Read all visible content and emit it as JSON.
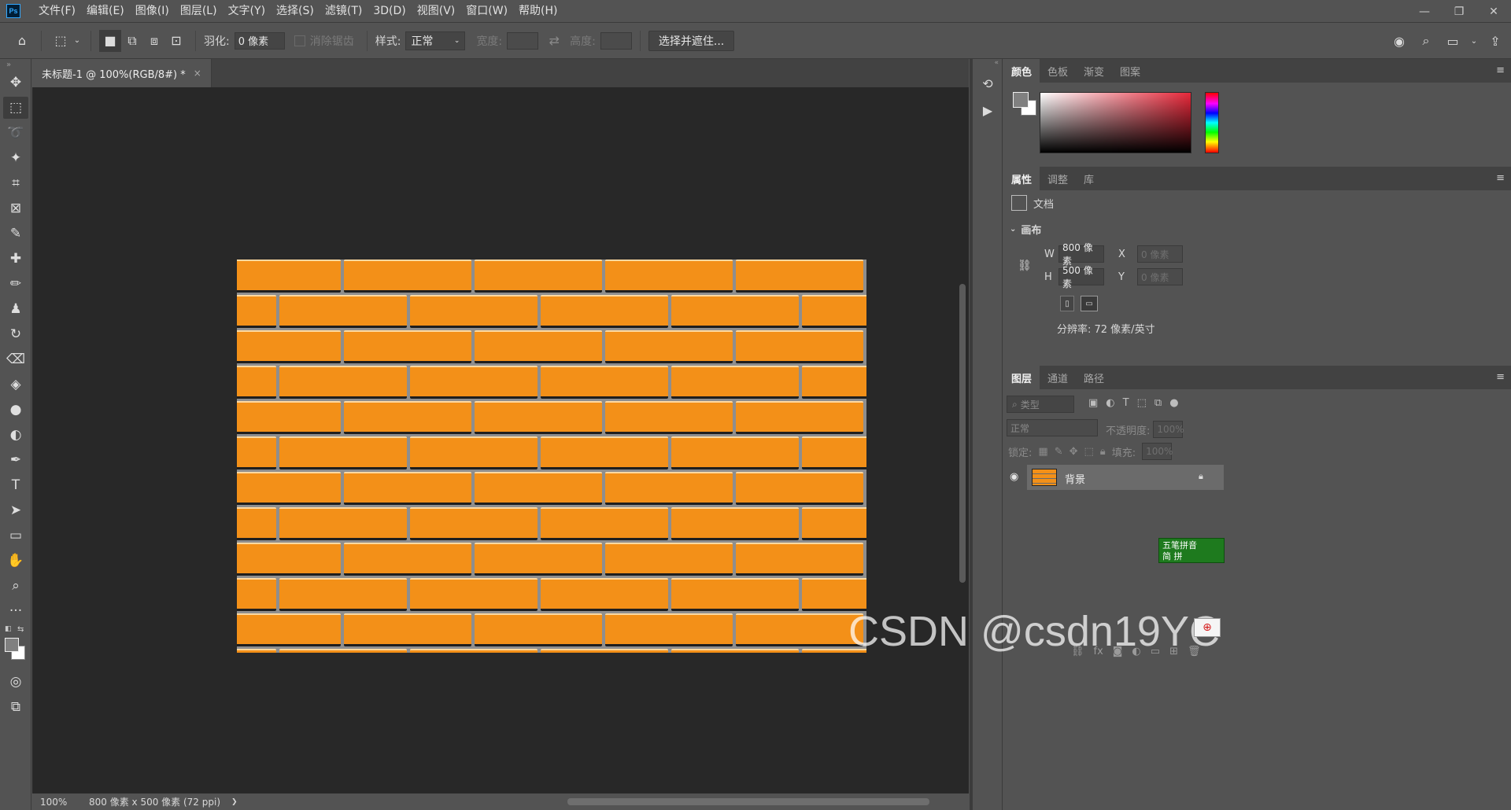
{
  "app": {
    "logo": "Ps"
  },
  "menu": [
    "文件(F)",
    "编辑(E)",
    "图像(I)",
    "图层(L)",
    "文字(Y)",
    "选择(S)",
    "滤镜(T)",
    "3D(D)",
    "视图(V)",
    "窗口(W)",
    "帮助(H)"
  ],
  "window_controls": {
    "minimize": "—",
    "restore": "❐",
    "close": "✕"
  },
  "options": {
    "feather_label": "羽化:",
    "feather_value": "0 像素",
    "antialias_label": "消除锯齿",
    "style_label": "样式:",
    "style_value": "正常",
    "width_label": "宽度:",
    "height_label": "高度:",
    "select_mask_button": "选择并遮住..."
  },
  "document": {
    "tab_title": "未标题-1 @ 100%(RGB/8#) *",
    "tab_close": "×",
    "zoom": "100%",
    "info": "800 像素 x 500 像素 (72 ppi)",
    "info_arrow": "❯"
  },
  "color_panel": {
    "tabs": [
      "颜色",
      "色板",
      "渐变",
      "图案"
    ],
    "active_tab": 0
  },
  "properties_panel": {
    "tabs": [
      "属性",
      "调整",
      "库"
    ],
    "doc_label": "文档",
    "section": "画布",
    "w_label": "W",
    "w_value": "800 像素",
    "h_label": "H",
    "h_value": "500 像素",
    "x_label": "X",
    "x_value": "0 像素",
    "y_label": "Y",
    "y_value": "0 像素",
    "resolution": "分辨率: 72 像素/英寸"
  },
  "layers_panel": {
    "tabs": [
      "图层",
      "通道",
      "路径"
    ],
    "filter_placeholder": "类型",
    "blend_mode": "正常",
    "opacity_label": "不透明度:",
    "opacity_value": "100%",
    "lock_label": "锁定:",
    "fill_label": "填充:",
    "fill_value": "100%",
    "layer_name": "背景"
  },
  "ime": {
    "line1": "五笔拼音",
    "line2": "简 拼"
  },
  "watermark": "CSDN @csdn19YC",
  "colors": {
    "brick": "#f39018",
    "canvas_bg": "#282828",
    "ui_bg": "#535353",
    "fg_color": "#808080",
    "bg_color": "#ffffff"
  }
}
